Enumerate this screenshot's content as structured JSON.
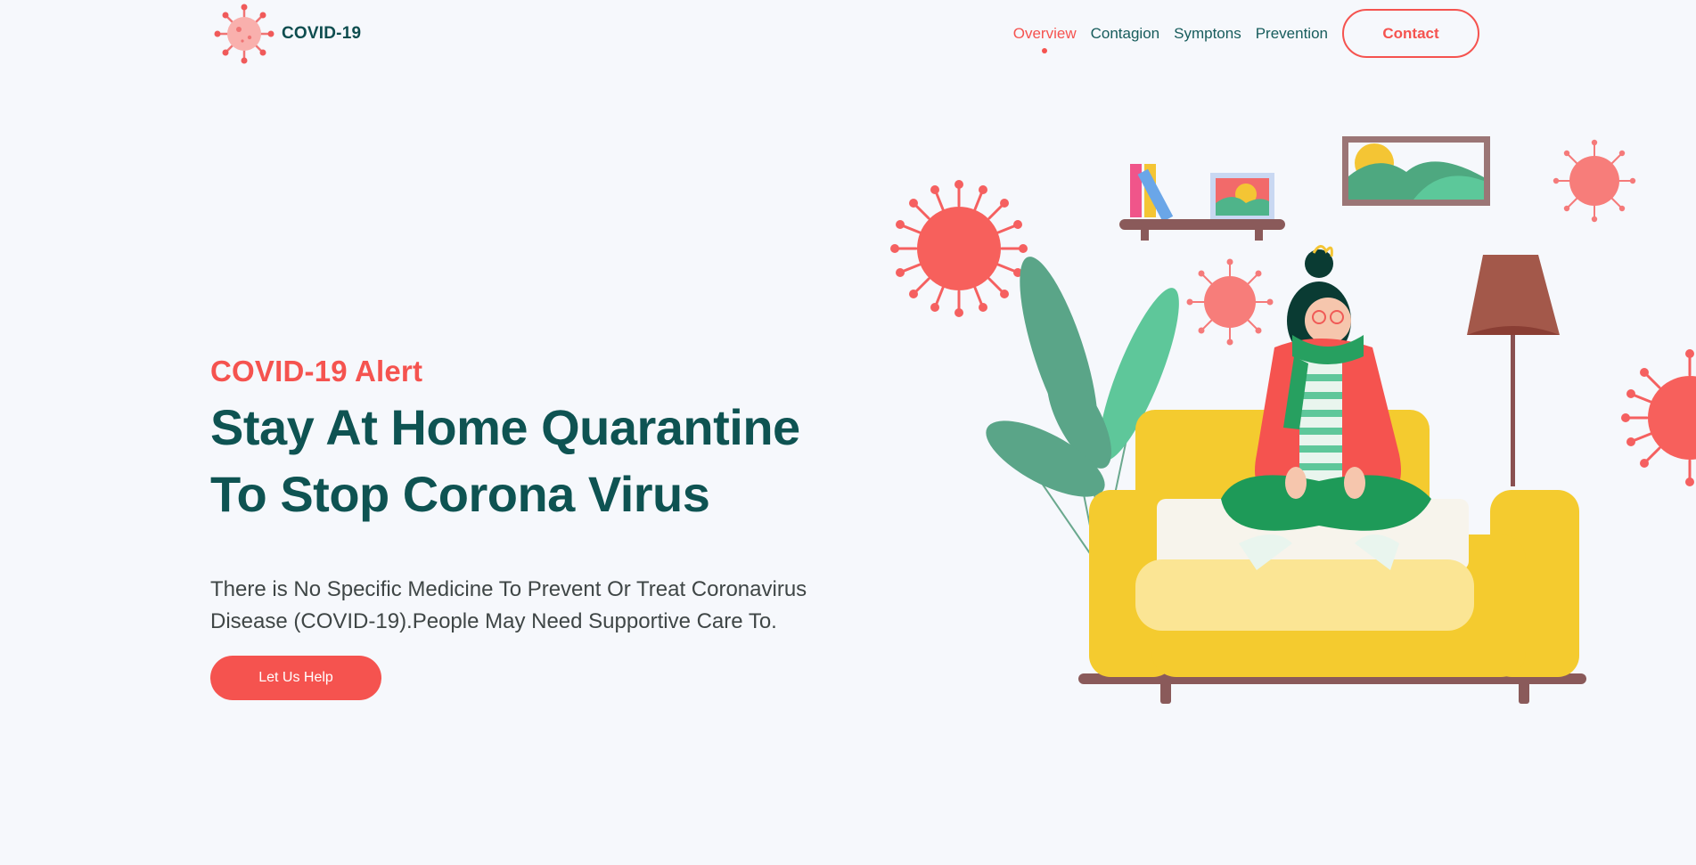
{
  "header": {
    "brand_name": "COVID-19",
    "nav": [
      {
        "label": "Overview",
        "active": true
      },
      {
        "label": "Contagion",
        "active": false
      },
      {
        "label": "Symptons",
        "active": false
      },
      {
        "label": "Prevention",
        "active": false
      }
    ],
    "contact_label": "Contact"
  },
  "hero": {
    "eyebrow": "COVID-19 Alert",
    "headline_line1": "Stay At Home Quarantine",
    "headline_line2": "To Stop Corona Virus",
    "description": "There is No Specific Medicine To Prevent Or Treat Coronavirus Disease (COVID-19).People May Need Supportive Care To.",
    "cta_label": "Let Us Help"
  },
  "colors": {
    "accent": "#f5534f",
    "heading": "#0e5352",
    "background": "#f6f8fc"
  },
  "icons": {
    "logo": "virus-logo-icon",
    "illustration": "stay-home-illustration"
  }
}
